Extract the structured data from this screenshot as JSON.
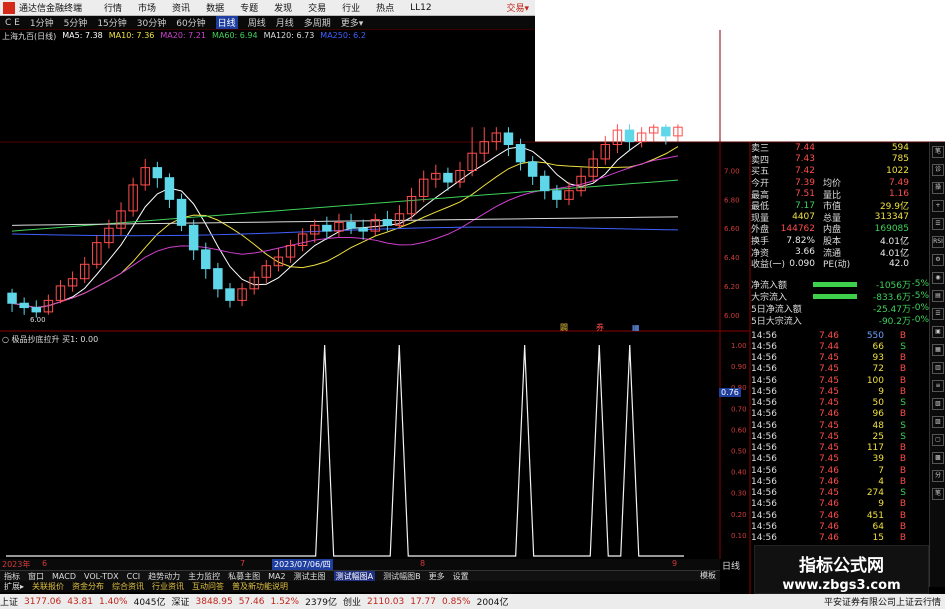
{
  "menubar": {
    "app_title": "通达信金融终端",
    "items": [
      "行情",
      "市场",
      "资讯",
      "数据",
      "专题",
      "发现",
      "交易",
      "行业",
      "热点",
      "LL12"
    ],
    "trade": "交易▾"
  },
  "periods": [
    {
      "label": "1分钟",
      "active": false
    },
    {
      "label": "5分钟",
      "active": false
    },
    {
      "label": "15分钟",
      "active": false
    },
    {
      "label": "30分钟",
      "active": false
    },
    {
      "label": "60分钟",
      "active": false
    },
    {
      "label": "日线",
      "active": true
    },
    {
      "label": "周线",
      "active": false
    },
    {
      "label": "月线",
      "active": false
    },
    {
      "label": "多周期",
      "active": false
    },
    {
      "label": "更多▾",
      "active": false
    }
  ],
  "period_prefix": "C E",
  "ma_legend": [
    {
      "text": "上海九百(日线)",
      "color": "#dddddd"
    },
    {
      "text": "MA5: 7.38",
      "color": "#ffffff"
    },
    {
      "text": "MA10: 7.36",
      "color": "#f0e040"
    },
    {
      "text": "MA20: 7.21",
      "color": "#d040d0"
    },
    {
      "text": "MA60: 6.94",
      "color": "#3fd15a"
    },
    {
      "text": "MA120: 6.73",
      "color": "#dddddd"
    },
    {
      "text": "MA250: 6.2",
      "color": "#4060ff"
    }
  ],
  "k_axis_labels": [
    "7.20",
    "7.00",
    "6.80",
    "6.60",
    "6.40",
    "6.20",
    "6.00"
  ],
  "low_mark": "6.00",
  "kline_markers": [
    {
      "text": "闢",
      "color": "#e0c040"
    },
    {
      "text": "券",
      "color": "#ff4d4d"
    },
    {
      "text": "▦",
      "color": "#6aa0ff"
    }
  ],
  "quote": {
    "rows": [
      {
        "k": "卖三",
        "v": "7.44",
        "v_color": "red",
        "k2": "",
        "v2": "594",
        "v2_color": "yellow"
      },
      {
        "k": "卖四",
        "v": "7.43",
        "v_color": "red",
        "k2": "",
        "v2": "785",
        "v2_color": "yellow"
      },
      {
        "k": "买五",
        "v": "7.42",
        "v_color": "red",
        "k2": "",
        "v2": "1022",
        "v2_color": "yellow"
      },
      {
        "k": "今开",
        "v": "7.39",
        "v_color": "red",
        "k2": "均价",
        "v2": "7.49",
        "v2_color": "red"
      },
      {
        "k": "最高",
        "v": "7.51",
        "v_color": "red",
        "k2": "量比",
        "v2": "1.16",
        "v2_color": "red"
      },
      {
        "k": "最低",
        "v": "7.17",
        "v_color": "green",
        "k2": "市值",
        "v2": "29.9亿",
        "v2_color": "yellow"
      },
      {
        "k": "现量",
        "v": "4407",
        "v_color": "yellow",
        "k2": "总量",
        "v2": "313347",
        "v2_color": "yellow"
      },
      {
        "k": "外盘",
        "v": "144762",
        "v_color": "red",
        "k2": "内盘",
        "v2": "169085",
        "v2_color": "green"
      },
      {
        "k": "换手",
        "v": "7.82%",
        "v_color": "white",
        "k2": "股本",
        "v2": "4.01亿",
        "v2_color": "white"
      },
      {
        "k": "净资",
        "v": "3.66",
        "v_color": "white",
        "k2": "流通",
        "v2": "4.01亿",
        "v2_color": "white"
      },
      {
        "k": "收益(一)",
        "v": "0.090",
        "v_color": "white",
        "k2": "PE(动)",
        "v2": "42.0",
        "v2_color": "white"
      }
    ]
  },
  "flow": [
    {
      "label": "净流入额",
      "bar": 44,
      "value": "-1056万",
      "pct": "-5%"
    },
    {
      "label": "大宗流入",
      "bar": 44,
      "value": "-833.6万",
      "pct": "-5%"
    },
    {
      "label": "5日净流入额",
      "bar": 0,
      "value": "-25.47万",
      "pct": "-0%"
    },
    {
      "label": "5日大宗流入",
      "bar": 0,
      "value": "-90.2万",
      "pct": "-0%"
    }
  ],
  "ticks": [
    {
      "t": "14:56",
      "p": "7.46",
      "v": "550",
      "d": "B",
      "v_color": "#6aa0ff"
    },
    {
      "t": "14:56",
      "p": "7.44",
      "v": "66",
      "d": "S"
    },
    {
      "t": "14:56",
      "p": "7.45",
      "v": "93",
      "d": "B"
    },
    {
      "t": "14:56",
      "p": "7.45",
      "v": "72",
      "d": "B"
    },
    {
      "t": "14:56",
      "p": "7.45",
      "v": "100",
      "d": "B"
    },
    {
      "t": "14:56",
      "p": "7.45",
      "v": "9",
      "d": "B"
    },
    {
      "t": "14:56",
      "p": "7.45",
      "v": "50",
      "d": "S"
    },
    {
      "t": "14:56",
      "p": "7.46",
      "v": "96",
      "d": "B"
    },
    {
      "t": "14:56",
      "p": "7.45",
      "v": "48",
      "d": "S"
    },
    {
      "t": "14:56",
      "p": "7.45",
      "v": "25",
      "d": "S"
    },
    {
      "t": "14:56",
      "p": "7.45",
      "v": "117",
      "d": "B"
    },
    {
      "t": "14:56",
      "p": "7.45",
      "v": "39",
      "d": "B"
    },
    {
      "t": "14:56",
      "p": "7.46",
      "v": "7",
      "d": "B"
    },
    {
      "t": "14:56",
      "p": "7.46",
      "v": "4",
      "d": "B"
    },
    {
      "t": "14:56",
      "p": "7.45",
      "v": "274",
      "d": "S"
    },
    {
      "t": "14:56",
      "p": "7.46",
      "v": "9",
      "d": "B"
    },
    {
      "t": "14:56",
      "p": "7.46",
      "v": "451",
      "d": "B"
    },
    {
      "t": "14:56",
      "p": "7.46",
      "v": "64",
      "d": "B"
    },
    {
      "t": "14:56",
      "p": "7.46",
      "v": "15",
      "d": "B"
    }
  ],
  "sidebar_icons": [
    "笔",
    "诊",
    "操",
    "+",
    "☰",
    "RSI",
    "⚙",
    "◉",
    "▤",
    "☰",
    "▣",
    "▦",
    "▥",
    "≡",
    "▧",
    "▨",
    "▢",
    "▩",
    "分",
    "笔"
  ],
  "indicator": {
    "legend": "○ 极品抄底拉升  买1: 0.00",
    "cursor_value": "0.76",
    "axis_labels": [
      "1.00",
      "0.90",
      "0.80",
      "0.70",
      "0.60",
      "0.50",
      "0.40",
      "0.30",
      "0.20",
      "0.10"
    ],
    "signal": [
      0,
      0,
      0,
      0,
      0,
      0,
      0,
      0,
      0,
      0,
      0,
      0,
      0,
      0,
      0,
      0,
      0,
      0,
      0,
      0,
      0,
      0,
      0,
      0,
      0,
      0,
      0,
      0,
      0,
      0,
      0,
      0,
      0,
      0,
      0,
      0,
      0,
      0,
      0,
      0,
      0,
      0,
      0,
      0,
      0,
      0,
      0,
      0,
      0,
      0,
      0,
      0,
      0,
      0,
      0,
      0,
      0,
      0,
      0,
      0,
      0,
      0,
      0,
      0,
      0,
      0,
      0,
      0,
      0,
      0,
      0,
      0,
      0,
      0,
      0,
      0,
      0,
      0,
      0,
      0,
      0,
      0,
      0,
      0,
      0,
      0,
      0,
      0,
      0,
      0,
      0,
      0,
      0,
      0,
      0,
      0,
      0,
      0,
      0,
      0,
      0,
      0,
      0,
      0,
      0,
      0,
      0,
      0,
      0,
      0,
      0,
      0,
      0,
      0,
      0,
      0
    ]
  },
  "chart_data": {
    "type": "candlestick",
    "ma_series": [
      {
        "name": "MA5",
        "color": "#ffffff"
      },
      {
        "name": "MA10",
        "color": "#f0e040"
      },
      {
        "name": "MA20",
        "color": "#d040d0"
      },
      {
        "name": "MA60",
        "color": "#3fd15a"
      },
      {
        "name": "MA120",
        "color": "#dddddd"
      },
      {
        "name": "MA250",
        "color": "#4060ff"
      }
    ],
    "ylim": [
      5.95,
      7.35
    ],
    "candles": [
      [
        6.15,
        6.08,
        6.18,
        6.02
      ],
      [
        6.08,
        6.05,
        6.12,
        6.0
      ],
      [
        6.05,
        6.02,
        6.1,
        5.98
      ],
      [
        6.02,
        6.1,
        6.14,
        6.0
      ],
      [
        6.1,
        6.2,
        6.24,
        6.08
      ],
      [
        6.2,
        6.25,
        6.3,
        6.16
      ],
      [
        6.25,
        6.35,
        6.4,
        6.22
      ],
      [
        6.35,
        6.5,
        6.55,
        6.32
      ],
      [
        6.5,
        6.6,
        6.66,
        6.46
      ],
      [
        6.6,
        6.72,
        6.78,
        6.55
      ],
      [
        6.72,
        6.9,
        6.95,
        6.68
      ],
      [
        6.9,
        7.02,
        7.08,
        6.86
      ],
      [
        7.02,
        6.95,
        7.06,
        6.88
      ],
      [
        6.95,
        6.8,
        6.98,
        6.74
      ],
      [
        6.8,
        6.62,
        6.84,
        6.58
      ],
      [
        6.62,
        6.45,
        6.66,
        6.38
      ],
      [
        6.45,
        6.32,
        6.5,
        6.25
      ],
      [
        6.32,
        6.18,
        6.36,
        6.12
      ],
      [
        6.18,
        6.1,
        6.22,
        6.05
      ],
      [
        6.1,
        6.18,
        6.22,
        6.06
      ],
      [
        6.18,
        6.26,
        6.3,
        6.14
      ],
      [
        6.26,
        6.34,
        6.38,
        6.22
      ],
      [
        6.34,
        6.4,
        6.46,
        6.3
      ],
      [
        6.4,
        6.48,
        6.52,
        6.36
      ],
      [
        6.48,
        6.56,
        6.6,
        6.44
      ],
      [
        6.56,
        6.62,
        6.66,
        6.5
      ],
      [
        6.62,
        6.58,
        6.68,
        6.52
      ],
      [
        6.58,
        6.64,
        6.7,
        6.54
      ],
      [
        6.64,
        6.6,
        6.7,
        6.56
      ],
      [
        6.6,
        6.58,
        6.66,
        6.52
      ],
      [
        6.58,
        6.66,
        6.7,
        6.55
      ],
      [
        6.66,
        6.62,
        6.72,
        6.58
      ],
      [
        6.62,
        6.7,
        6.76,
        6.6
      ],
      [
        6.7,
        6.82,
        6.88,
        6.66
      ],
      [
        6.82,
        6.94,
        7.0,
        6.78
      ],
      [
        6.94,
        6.98,
        7.04,
        6.88
      ],
      [
        6.98,
        6.92,
        7.02,
        6.86
      ],
      [
        6.92,
        7.0,
        7.06,
        6.88
      ],
      [
        7.0,
        7.12,
        7.3,
        6.96
      ],
      [
        7.12,
        7.2,
        7.3,
        7.06
      ],
      [
        7.2,
        7.26,
        7.3,
        7.14
      ],
      [
        7.26,
        7.18,
        7.3,
        7.1
      ],
      [
        7.18,
        7.06,
        7.22,
        7.0
      ],
      [
        7.06,
        6.96,
        7.1,
        6.9
      ],
      [
        6.96,
        6.86,
        7.0,
        6.8
      ],
      [
        6.86,
        6.8,
        6.9,
        6.74
      ],
      [
        6.8,
        6.86,
        6.92,
        6.76
      ],
      [
        6.86,
        6.96,
        7.02,
        6.82
      ],
      [
        6.96,
        7.08,
        7.14,
        6.92
      ],
      [
        7.08,
        7.18,
        7.24,
        7.04
      ],
      [
        7.18,
        7.28,
        7.32,
        7.12
      ],
      [
        7.28,
        7.2,
        7.32,
        7.14
      ],
      [
        7.2,
        7.26,
        7.3,
        7.16
      ],
      [
        7.26,
        7.3,
        7.32,
        7.2
      ],
      [
        7.3,
        7.24,
        7.32,
        7.18
      ],
      [
        7.24,
        7.3,
        7.32,
        7.2
      ]
    ]
  },
  "ind_signal_spikes": [
    0.47,
    0.58,
    0.765,
    0.875,
    0.92
  ],
  "dates": [
    {
      "text": "2023年",
      "sel": false
    },
    {
      "text": "6",
      "sel": false
    },
    {
      "text": "7",
      "sel": false
    },
    {
      "text": "2023/07/06/四",
      "sel": true
    },
    {
      "text": "8",
      "sel": false
    },
    {
      "text": "9",
      "sel": false
    }
  ],
  "rixian": "日线",
  "tabs": [
    "指标",
    "窗口",
    "MACD",
    "VOL-TDX",
    "CCI",
    "趋势动力",
    "主力监控",
    "私募主图",
    "MA2",
    "测试主图",
    "测试幅图A",
    "测试幅图B",
    "更多",
    "设置"
  ],
  "active_tab": "测试幅图A",
  "moban": "模板",
  "toolrow": [
    "扩展▸",
    "关联报价",
    "资金分布",
    "综合资讯",
    "行业资讯",
    "互动问答",
    "普及新功能说明"
  ],
  "status": {
    "sh_label": "上证",
    "sh_price": "3177.06",
    "sh_chg": "43.81",
    "sh_pct": "1.40%",
    "sh_amt": "4045亿",
    "sz_label": "深证",
    "sz_price": "3848.95",
    "sz_chg": "57.46",
    "sz_pct": "1.52%",
    "sz_amt": "2379亿",
    "cy_label": "创业",
    "cy_price": "2110.03",
    "cy_chg": "17.77",
    "cy_pct": "0.85%",
    "cy_amt": "2004亿",
    "broker": "平安证券有限公司上证云行情"
  },
  "watermark": {
    "line1": "指标公式网",
    "line2": "www.zbgs3.com"
  }
}
